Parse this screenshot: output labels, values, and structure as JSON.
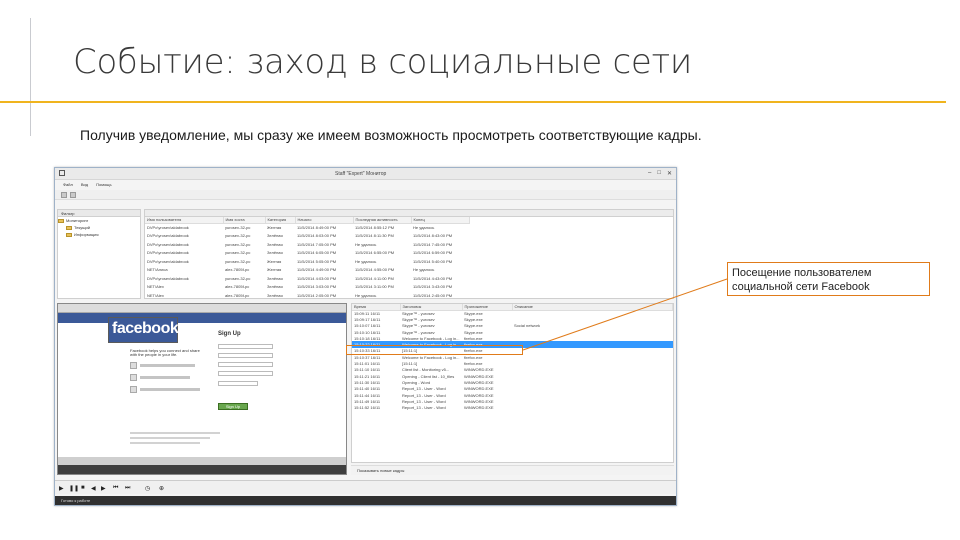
{
  "slide": {
    "title": "Событие: заход в социальные сети",
    "subtitle": "Получив уведомление, мы сразу же имеем возможность просмотреть соответствующие кадры.",
    "callout": "Посещение пользователем социальной сети Facebook"
  },
  "colors": {
    "accent": "#f0b41e",
    "callout": "#e07b1a",
    "facebook": "#3b5998",
    "selection": "#3399ff"
  },
  "app": {
    "title": "Staff \"Expert\" Монитор",
    "menu": [
      "Файл",
      "Вид",
      "Помощь"
    ],
    "tree": {
      "header": "Фильтр",
      "items": [
        "Мониторинг",
        "Текущий",
        "Информация"
      ]
    },
    "grid": {
      "columns": [
        "Имя пользователя",
        "Имя хоста",
        "Категория",
        "Начало",
        "Последняя активность",
        "Конец"
      ],
      "rows": [
        [
          "DVPc\\yrosev\\aldabrook",
          "yurosev-32-pc",
          "Желтая",
          "11/5/2014 8:49:00 PM",
          "11/5/2014 8:55:12 PM",
          "Не удалось"
        ],
        [
          "DVPc\\yrosev\\aldabrook",
          "yurosev-32-pc",
          "Зелёная",
          "11/5/2014 8:03:00 PM",
          "11/5/2014 8:11:30 PM",
          "11/5/2014 8:43:00 PM"
        ],
        [
          "DVPc\\yrosev\\aldabrook",
          "yurosev-32-pc",
          "Зелёная",
          "11/5/2014 7:05:00 PM",
          "Не удалось",
          "11/5/2014 7:45:00 PM"
        ],
        [
          "DVPc\\yrosev\\aldabrook",
          "yurosev-32-pc",
          "Зелёная",
          "11/5/2014 6:05:00 PM",
          "11/5/2014 6:55:00 PM",
          "11/5/2014 6:59:00 PM"
        ],
        [
          "DVPc\\yrosev\\aldabrook",
          "yurosev-32-pc",
          "Желтая",
          "11/5/2014 5:05:00 PM",
          "Не удалось",
          "11/5/2014 5:40:00 PM"
        ],
        [
          "NET\\Алиса",
          "alex-7805f-pc",
          "Желтая",
          "11/5/2014 4:49:00 PM",
          "11/5/2014 4:55:00 PM",
          "Не удалось"
        ],
        [
          "DVPc\\yrosev\\aldabrook",
          "yurosev-32-pc",
          "Зелёная",
          "11/5/2014 4:03:00 PM",
          "11/5/2014 4:11:00 PM",
          "11/5/2014 4:43:00 PM"
        ],
        [
          "NET\\Alex",
          "alex-7805f-pc",
          "Зелёная",
          "11/5/2014 3:03:00 PM",
          "11/5/2014 3:11:00 PM",
          "11/5/2014 3:43:00 PM"
        ],
        [
          "NET\\Alex",
          "alex-7805f-pc",
          "Зелёная",
          "11/5/2014 2:05:00 PM",
          "Не удалось",
          "11/5/2014 2:45:00 PM"
        ],
        [
          "DVPc\\yrosev\\aldabrook",
          "yurosev-32-pc",
          "Зелёная",
          "11/5/2014 1:05:00 PM",
          "11/5/2014 1:55:00 PM",
          "11/5/2014 1:59:00 PM"
        ]
      ]
    },
    "preview": {
      "logo": "facebook",
      "tagline": "Facebook helps you connect and share with the people in your life.",
      "signup": "Sign Up",
      "button": "Sign Up"
    },
    "events": {
      "columns": [
        "Время",
        "Заголовок",
        "Приложение",
        "Описание"
      ],
      "rows": [
        [
          "15:09:11 16/11",
          "Skype™ - yurosev",
          "Skype.exe",
          ""
        ],
        [
          "15:09:17 16/11",
          "Skype™ - yurosev",
          "Skype.exe",
          ""
        ],
        [
          "15:10:07 16/11",
          "Skype™ - yurosev",
          "Skype.exe",
          "Social network"
        ],
        [
          "15:10:10 16/11",
          "Skype™ - yurosev",
          "Skype.exe",
          ""
        ],
        [
          "15:10:18 16/11",
          "Welcome to Facebook - Log in...",
          "firefox.exe",
          ""
        ],
        [
          "15:10:22 16/11",
          "Welcome to Facebook - Log in...",
          "firefox.exe",
          ""
        ],
        [
          "15:10:33 16/11",
          "[15:11:1]",
          "firefox.exe",
          ""
        ],
        [
          "15:10:37 16/11",
          "Welcome to Facebook - Log in...",
          "firefox.exe",
          ""
        ],
        [
          "15:11:01 16/11",
          "[15:11:1]",
          "firefox.exe",
          ""
        ],
        [
          "15:11:10 16/11",
          "Client list - Monitoring v5...",
          "WINWORD.EXE",
          ""
        ],
        [
          "15:11:21 16/11",
          "Opening - Client list - 10_files",
          "WINWORD.EXE",
          ""
        ],
        [
          "15:11:30 16/11",
          "Opening - Word",
          "WINWORD.EXE",
          ""
        ],
        [
          "15:11:40 16/11",
          "Report_13 - User - Word",
          "WINWORD.EXE",
          ""
        ],
        [
          "15:11:44 16/11",
          "Report_13 - User - Word",
          "WINWORD.EXE",
          ""
        ],
        [
          "15:11:49 16/11",
          "Report_13 - User - Word",
          "WINWORD.EXE",
          ""
        ],
        [
          "15:11:52 16/11",
          "Report_13 - User - Word",
          "WINWORD.EXE",
          ""
        ]
      ],
      "footer": "Показывать новые кадры"
    },
    "status": "Готово к работе"
  }
}
